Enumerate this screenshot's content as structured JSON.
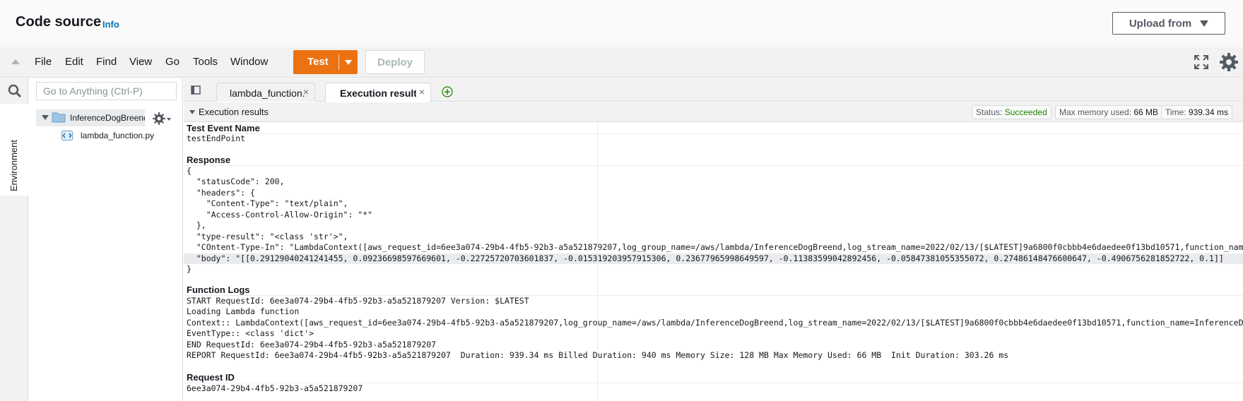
{
  "header": {
    "title": "Code source",
    "info_link": "Info",
    "upload_button": "Upload from"
  },
  "menubar": {
    "items": [
      "File",
      "Edit",
      "Find",
      "View",
      "Go",
      "Tools",
      "Window"
    ],
    "test_button": "Test",
    "deploy_button": "Deploy"
  },
  "sidebar": {
    "environment_tab": "Environment",
    "goto_placeholder": "Go to Anything (Ctrl-P)",
    "folder_name": "InferenceDogBreend",
    "file_name": "lambda_function.py"
  },
  "tabs": [
    {
      "label": "lambda_function.py",
      "close": "×"
    },
    {
      "label": "Execution results",
      "close": "×"
    }
  ],
  "results": {
    "title": "Execution results",
    "status_label": "Status:",
    "status_value": "Succeeded",
    "memory_label": "Max memory used:",
    "memory_value": "66 MB",
    "time_label": "Time:",
    "time_value": "939.34 ms",
    "test_event_title": "Test Event Name",
    "test_event_value": "testEndPoint",
    "response_title": "Response",
    "response_lines": [
      "{",
      "  \"statusCode\": 200,",
      "  \"headers\": {",
      "    \"Content-Type\": \"text/plain\",",
      "    \"Access-Control-Allow-Origin\": \"*\"",
      "  },",
      "  \"type-result\": \"<class 'str'>\",",
      "  \"COntent-Type-In\": \"LambdaContext([aws_request_id=6ee3a074-29b4-4fb5-92b3-a5a521879207,log_group_name=/aws/lambda/InferenceDogBreend,log_stream_name=2022/02/13/[$LATEST]9a6800f0cbbb4e6daedee0f13bd10571,function_name=InferenceDogBreend",
      "  \"body\": \"[[0.29129040241241455, 0.09236698597669601, -0.22725720703601837, -0.015319203957915306, 0.23677965998649597, -0.11383599042892456, -0.05847381055355072, 0.27486148476600647, -0.4906756281852722, 0.1]]",
      "}"
    ],
    "logs_title": "Function Logs",
    "log_lines": [
      "START RequestId: 6ee3a074-29b4-4fb5-92b3-a5a521879207 Version: $LATEST",
      "Loading Lambda function",
      "Context:: LambdaContext([aws_request_id=6ee3a074-29b4-4fb5-92b3-a5a521879207,log_group_name=/aws/lambda/InferenceDogBreend,log_stream_name=2022/02/13/[$LATEST]9a6800f0cbbb4e6daedee0f13bd10571,function_name=InferenceDogBreend",
      "EventType:: <class 'dict'>",
      "END RequestId: 6ee3a074-29b4-4fb5-92b3-a5a521879207",
      "REPORT RequestId: 6ee3a074-29b4-4fb5-92b3-a5a521879207  Duration: 939.34 ms Billed Duration: 940 ms Memory Size: 128 MB Max Memory Used: 66 MB  Init Duration: 303.26 ms"
    ],
    "request_id_title": "Request ID",
    "request_id_value": "6ee3a074-29b4-4fb5-92b3-a5a521879207"
  },
  "colors": {
    "accent": "#ec7211",
    "link": "#0073bb",
    "success": "#1d8102"
  }
}
